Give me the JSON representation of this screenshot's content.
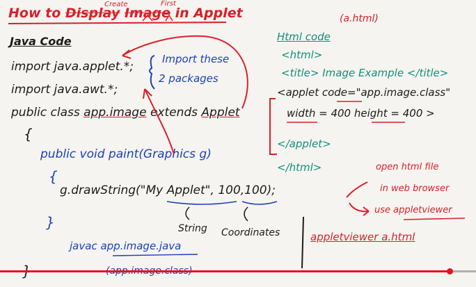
{
  "title": {
    "prefix": "How to",
    "struck_1": "Display",
    "struck_2": "Image",
    "in_applet": "in Applet",
    "insert_1": "Create",
    "insert_2": "First"
  },
  "java_section": {
    "heading": "Java Code",
    "imports": [
      "import java.applet.*;",
      "import java.awt.*;"
    ],
    "import_note": [
      "Import these",
      "2 packages"
    ],
    "class_decl": {
      "pre": "public class",
      "class_name": "app.image",
      "extends": "extends",
      "parent": "Applet"
    },
    "open_brace": "{",
    "paint_sig": "public void paint(Graphics g)",
    "paint_open": "{",
    "draw_call": {
      "method": "g.drawString(",
      "arg": "\"My Applet\"",
      "comma": ",",
      "coords": "100,100",
      "end": ");"
    },
    "paint_close": "}",
    "string_label": "String",
    "coords_label": "Coordinates",
    "compile": "javac app.image.java",
    "compile_out": "(app.image.class)",
    "close_brace": "}"
  },
  "html_section": {
    "filename": "(a.html)",
    "heading": "Html code",
    "lines": [
      "<html>",
      "<title> Image Example </title>",
      "<applet code=\"app.image.class\"",
      "width = 400  height = 400 >",
      "</applet>",
      "</html>"
    ]
  },
  "notes": {
    "run_1": "open html file",
    "run_2": "in web browser",
    "run_3": "use appletviewer",
    "cmd": "appletviewer a.html"
  },
  "player": {
    "progress": 0.945
  },
  "colors": {
    "board": "#f5f4f0",
    "red": "#d8202a",
    "black": "#1b1b1b",
    "blue": "#1d3fb8",
    "green": "#12907a"
  }
}
